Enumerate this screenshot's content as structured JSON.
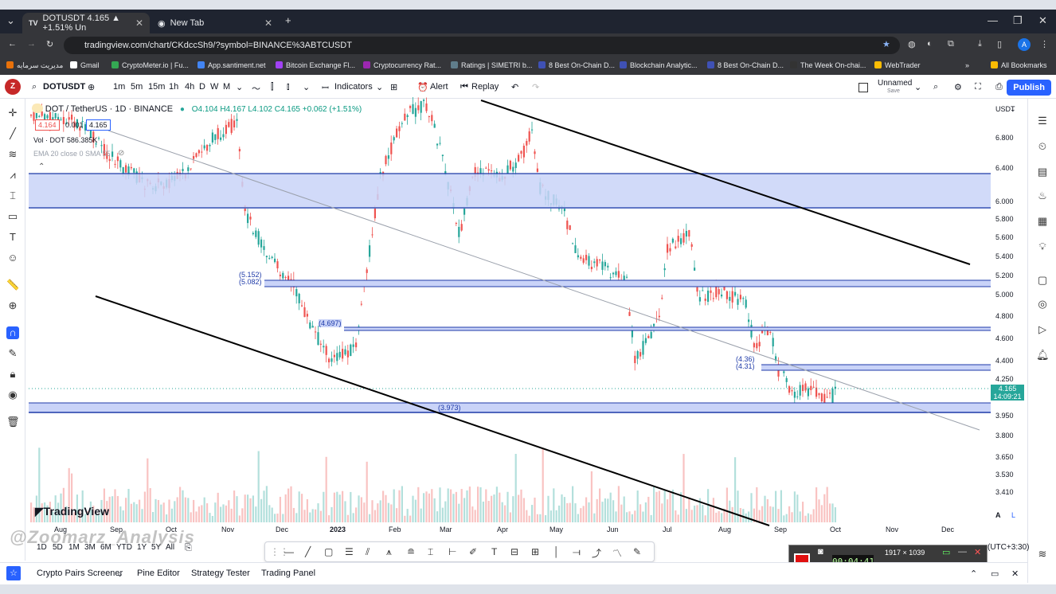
{
  "browser": {
    "tabs": [
      {
        "title": "DOTUSDT 4.165 ▲ +1.51% Un"
      },
      {
        "title": "New Tab"
      }
    ],
    "url": "tradingview.com/chart/CKdccSh9/?symbol=BINANCE%3ABTCUSDT",
    "bookmarks": [
      "مدیریت سرمایه",
      "Gmail",
      "CryptoMeter.io | Fu...",
      "App.santiment.net",
      "Bitcoin Exchange Fl...",
      "Cryptocurrency Rat...",
      "Ratings | SIMETRI b...",
      "8 Best On-Chain D...",
      "Blockchain Analytic...",
      "8 Best On-Chain D...",
      "The Week On-chai...",
      "WebTrader"
    ],
    "all_bookmarks": "All Bookmarks"
  },
  "toolbar": {
    "symbol": "DOTUSDT",
    "intervals": [
      "1m",
      "5m",
      "15m",
      "1h",
      "4h",
      "D",
      "W",
      "M"
    ],
    "indicators": "Indicators",
    "alert": "Alert",
    "replay": "Replay",
    "layout_name": "Unnamed",
    "layout_sub": "Save",
    "publish": "Publish"
  },
  "legend": {
    "title": "DOT / TetherUS · 1D · BINANCE",
    "ohlc": "O4.104 H4.167 L4.102 C4.165 +0.062 (+1.51%)",
    "bid": "4.164",
    "spread": "0.001",
    "ask": "4.165",
    "volume": "Vol · DOT  586.385K",
    "ema": "EMA 20 close 0 SMA 55"
  },
  "price_axis": {
    "currency": "USDT",
    "ticks": [
      "6.800",
      "6.400",
      "6.000",
      "5.800",
      "5.600",
      "5.400",
      "5.200",
      "5.000",
      "4.800",
      "4.600",
      "4.400",
      "4.250",
      "3.950",
      "3.800",
      "3.650",
      "3.530",
      "3.410"
    ],
    "current_price": "4.165",
    "countdown": "14:09:21"
  },
  "time_axis": [
    "Aug",
    "Sep",
    "Oct",
    "Nov",
    "Dec",
    "2023",
    "Feb",
    "Mar",
    "Apr",
    "May",
    "Jun",
    "Jul",
    "Aug",
    "Sep",
    "Oct",
    "Nov",
    "Dec"
  ],
  "level_labels": [
    "(5.152)",
    "(5.082)",
    "(4.697)",
    "(4.36)",
    "(4.31)",
    "(3.973)"
  ],
  "bottom": {
    "ranges": [
      "1D",
      "5D",
      "1M",
      "3M",
      "6M",
      "YTD",
      "1Y",
      "5Y",
      "All"
    ],
    "timezone": "(UTC+3:30)"
  },
  "footer": {
    "tabs": [
      "Crypto Pairs Screener",
      "Pine Editor",
      "Strategy Tester",
      "Trading Panel"
    ]
  },
  "recorder": {
    "time": "00:04:41",
    "resolution": "1917 × 1039"
  },
  "watermark": "@Zoomarz_Analysis",
  "logo": "TradingView",
  "colors": {
    "zone": "#c9d3f8",
    "zone_line": "#1e3aa8",
    "up": "#26a69a",
    "down": "#ef5350",
    "accent": "#2962ff"
  }
}
